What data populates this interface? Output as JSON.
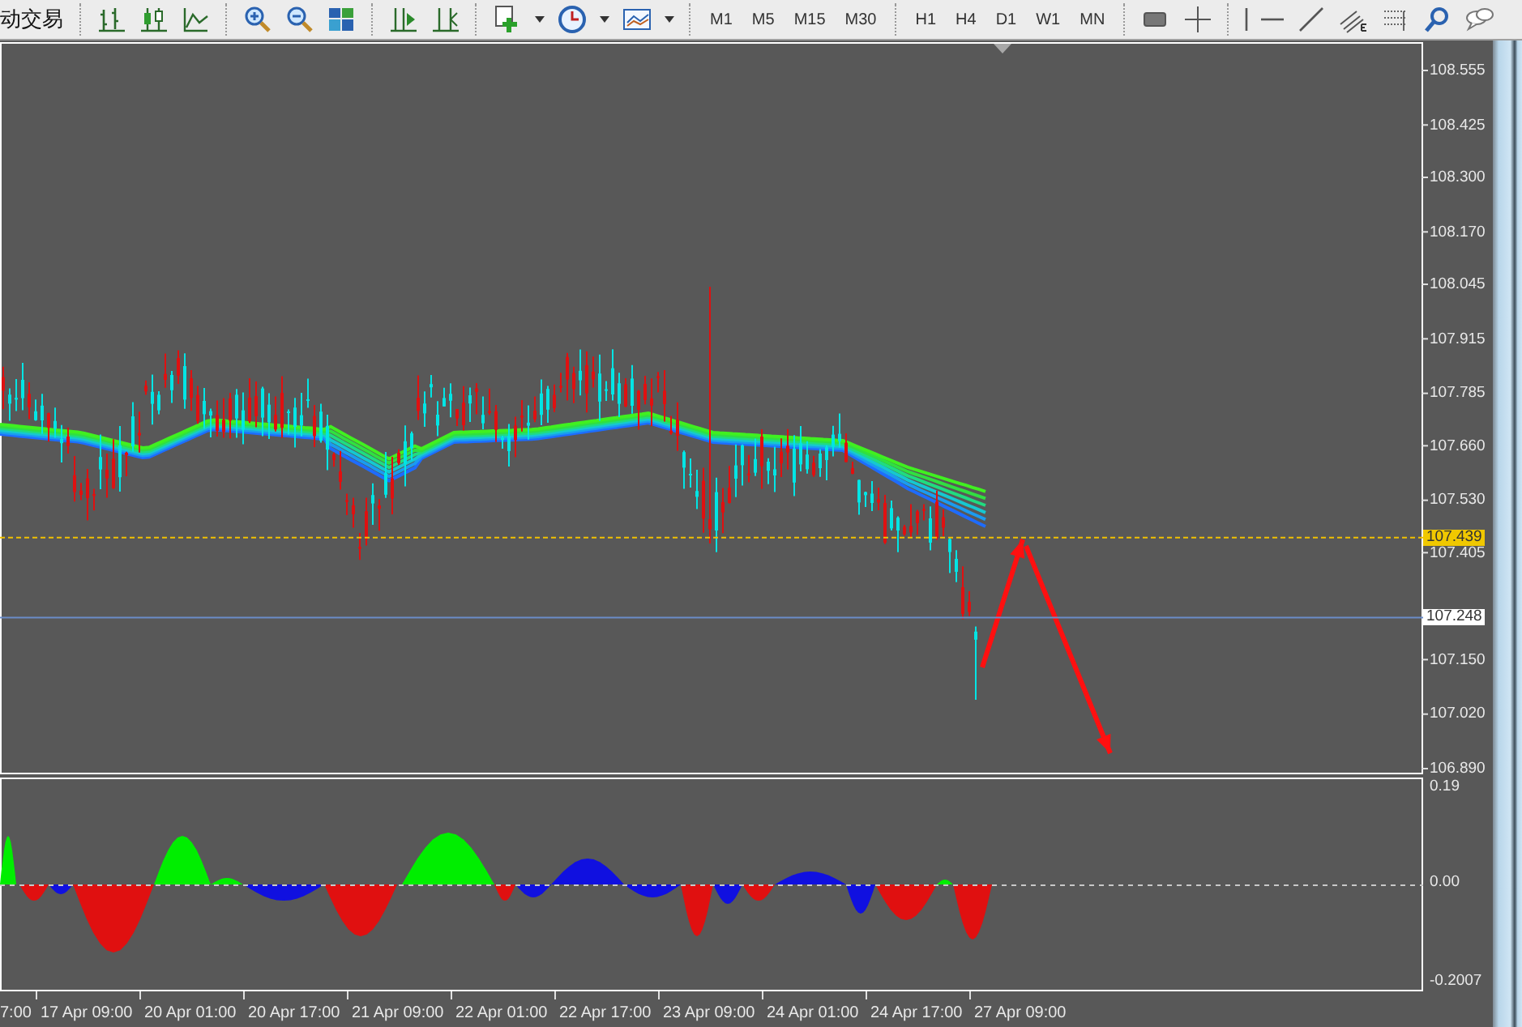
{
  "toolbar": {
    "trading_button": "动交易",
    "timeframes": [
      "M1",
      "M5",
      "M15",
      "M30",
      "H1",
      "H4",
      "D1",
      "W1",
      "MN"
    ]
  },
  "price_axis": {
    "ticks": [
      "108.555",
      "108.425",
      "108.300",
      "108.170",
      "108.045",
      "107.915",
      "107.785",
      "107.660",
      "107.530",
      "107.405",
      "107.150",
      "107.020",
      "106.890"
    ]
  },
  "price_lines": [
    {
      "kind": "dashed",
      "label": "107.439"
    },
    {
      "kind": "solid",
      "label": "107.248"
    }
  ],
  "indicator_axis": {
    "ticks": [
      "0.19",
      "0.00",
      "-0.2007"
    ]
  },
  "time_axis": {
    "labels": [
      "7:00",
      "17 Apr 09:00",
      "20 Apr 01:00",
      "20 Apr 17:00",
      "21 Apr 09:00",
      "22 Apr 01:00",
      "22 Apr 17:00",
      "23 Apr 09:00",
      "24 Apr 01:00",
      "24 Apr 17:00",
      "27 Apr 09:00"
    ]
  }
}
